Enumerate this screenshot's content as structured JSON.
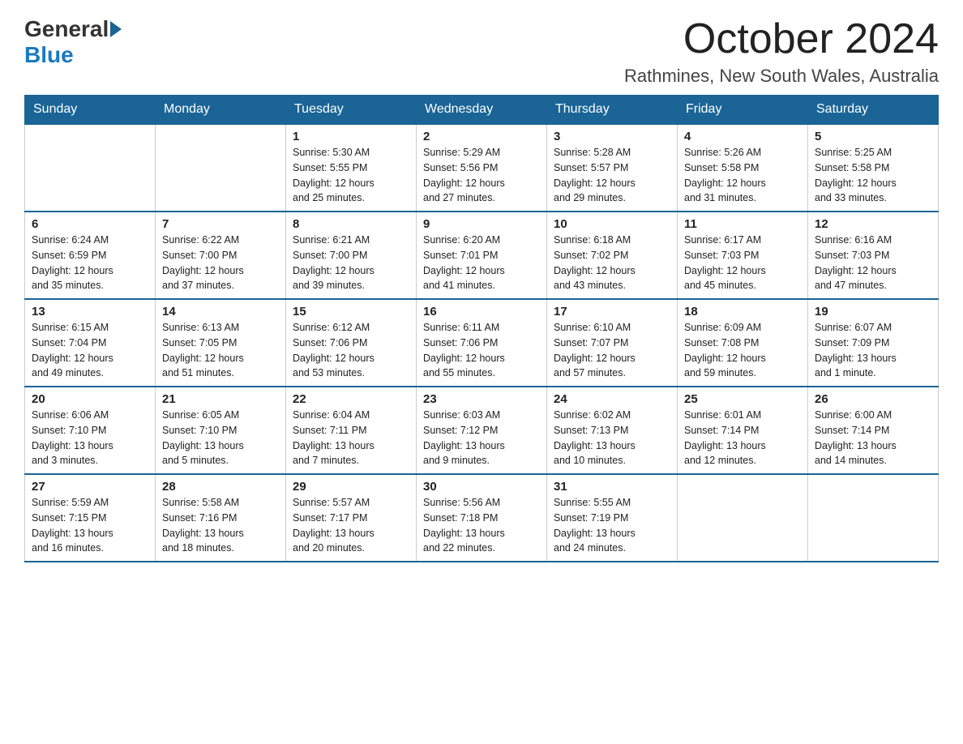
{
  "logo": {
    "general": "General",
    "blue": "Blue"
  },
  "title": "October 2024",
  "location": "Rathmines, New South Wales, Australia",
  "days_of_week": [
    "Sunday",
    "Monday",
    "Tuesday",
    "Wednesday",
    "Thursday",
    "Friday",
    "Saturday"
  ],
  "weeks": [
    [
      {
        "day": "",
        "info": ""
      },
      {
        "day": "",
        "info": ""
      },
      {
        "day": "1",
        "info": "Sunrise: 5:30 AM\nSunset: 5:55 PM\nDaylight: 12 hours\nand 25 minutes."
      },
      {
        "day": "2",
        "info": "Sunrise: 5:29 AM\nSunset: 5:56 PM\nDaylight: 12 hours\nand 27 minutes."
      },
      {
        "day": "3",
        "info": "Sunrise: 5:28 AM\nSunset: 5:57 PM\nDaylight: 12 hours\nand 29 minutes."
      },
      {
        "day": "4",
        "info": "Sunrise: 5:26 AM\nSunset: 5:58 PM\nDaylight: 12 hours\nand 31 minutes."
      },
      {
        "day": "5",
        "info": "Sunrise: 5:25 AM\nSunset: 5:58 PM\nDaylight: 12 hours\nand 33 minutes."
      }
    ],
    [
      {
        "day": "6",
        "info": "Sunrise: 6:24 AM\nSunset: 6:59 PM\nDaylight: 12 hours\nand 35 minutes."
      },
      {
        "day": "7",
        "info": "Sunrise: 6:22 AM\nSunset: 7:00 PM\nDaylight: 12 hours\nand 37 minutes."
      },
      {
        "day": "8",
        "info": "Sunrise: 6:21 AM\nSunset: 7:00 PM\nDaylight: 12 hours\nand 39 minutes."
      },
      {
        "day": "9",
        "info": "Sunrise: 6:20 AM\nSunset: 7:01 PM\nDaylight: 12 hours\nand 41 minutes."
      },
      {
        "day": "10",
        "info": "Sunrise: 6:18 AM\nSunset: 7:02 PM\nDaylight: 12 hours\nand 43 minutes."
      },
      {
        "day": "11",
        "info": "Sunrise: 6:17 AM\nSunset: 7:03 PM\nDaylight: 12 hours\nand 45 minutes."
      },
      {
        "day": "12",
        "info": "Sunrise: 6:16 AM\nSunset: 7:03 PM\nDaylight: 12 hours\nand 47 minutes."
      }
    ],
    [
      {
        "day": "13",
        "info": "Sunrise: 6:15 AM\nSunset: 7:04 PM\nDaylight: 12 hours\nand 49 minutes."
      },
      {
        "day": "14",
        "info": "Sunrise: 6:13 AM\nSunset: 7:05 PM\nDaylight: 12 hours\nand 51 minutes."
      },
      {
        "day": "15",
        "info": "Sunrise: 6:12 AM\nSunset: 7:06 PM\nDaylight: 12 hours\nand 53 minutes."
      },
      {
        "day": "16",
        "info": "Sunrise: 6:11 AM\nSunset: 7:06 PM\nDaylight: 12 hours\nand 55 minutes."
      },
      {
        "day": "17",
        "info": "Sunrise: 6:10 AM\nSunset: 7:07 PM\nDaylight: 12 hours\nand 57 minutes."
      },
      {
        "day": "18",
        "info": "Sunrise: 6:09 AM\nSunset: 7:08 PM\nDaylight: 12 hours\nand 59 minutes."
      },
      {
        "day": "19",
        "info": "Sunrise: 6:07 AM\nSunset: 7:09 PM\nDaylight: 13 hours\nand 1 minute."
      }
    ],
    [
      {
        "day": "20",
        "info": "Sunrise: 6:06 AM\nSunset: 7:10 PM\nDaylight: 13 hours\nand 3 minutes."
      },
      {
        "day": "21",
        "info": "Sunrise: 6:05 AM\nSunset: 7:10 PM\nDaylight: 13 hours\nand 5 minutes."
      },
      {
        "day": "22",
        "info": "Sunrise: 6:04 AM\nSunset: 7:11 PM\nDaylight: 13 hours\nand 7 minutes."
      },
      {
        "day": "23",
        "info": "Sunrise: 6:03 AM\nSunset: 7:12 PM\nDaylight: 13 hours\nand 9 minutes."
      },
      {
        "day": "24",
        "info": "Sunrise: 6:02 AM\nSunset: 7:13 PM\nDaylight: 13 hours\nand 10 minutes."
      },
      {
        "day": "25",
        "info": "Sunrise: 6:01 AM\nSunset: 7:14 PM\nDaylight: 13 hours\nand 12 minutes."
      },
      {
        "day": "26",
        "info": "Sunrise: 6:00 AM\nSunset: 7:14 PM\nDaylight: 13 hours\nand 14 minutes."
      }
    ],
    [
      {
        "day": "27",
        "info": "Sunrise: 5:59 AM\nSunset: 7:15 PM\nDaylight: 13 hours\nand 16 minutes."
      },
      {
        "day": "28",
        "info": "Sunrise: 5:58 AM\nSunset: 7:16 PM\nDaylight: 13 hours\nand 18 minutes."
      },
      {
        "day": "29",
        "info": "Sunrise: 5:57 AM\nSunset: 7:17 PM\nDaylight: 13 hours\nand 20 minutes."
      },
      {
        "day": "30",
        "info": "Sunrise: 5:56 AM\nSunset: 7:18 PM\nDaylight: 13 hours\nand 22 minutes."
      },
      {
        "day": "31",
        "info": "Sunrise: 5:55 AM\nSunset: 7:19 PM\nDaylight: 13 hours\nand 24 minutes."
      },
      {
        "day": "",
        "info": ""
      },
      {
        "day": "",
        "info": ""
      }
    ]
  ]
}
